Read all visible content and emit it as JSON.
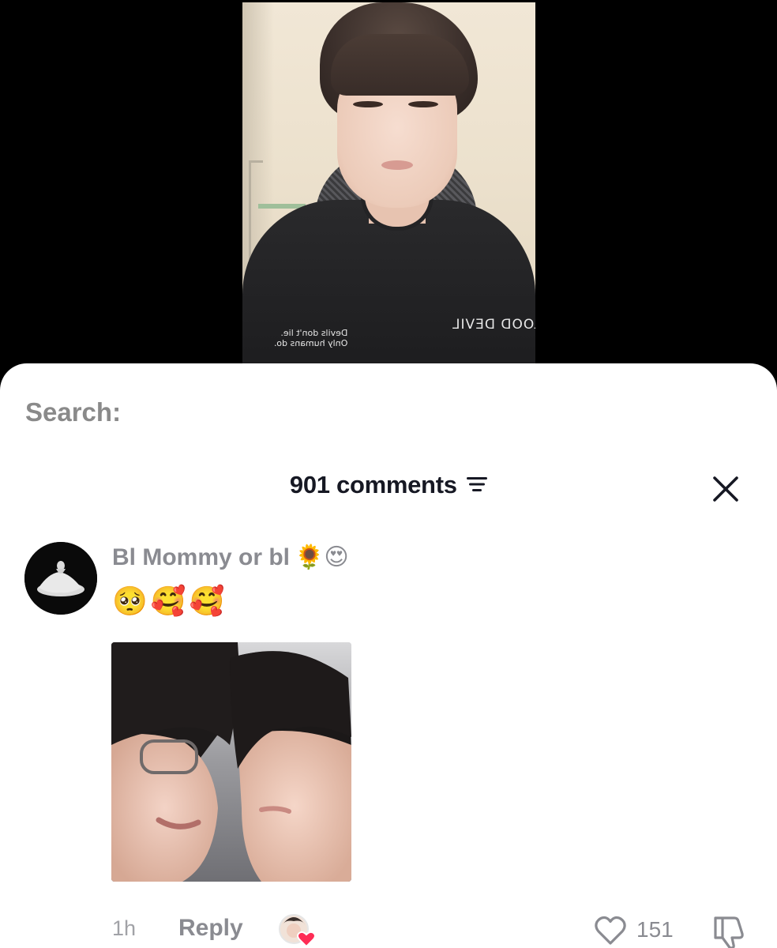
{
  "video": {
    "shirt_text_small": "Devils don't lie.\nOnly humans do.",
    "shirt_text_brand": "BLOOD DEVIL"
  },
  "search": {
    "label": "Search:"
  },
  "comments": {
    "count_label": "901 comments",
    "sort_icon": "sort-lines-icon",
    "close_icon": "close-x-icon"
  },
  "comment": {
    "username": "Bl Mommy or bl",
    "username_emojis": "🌻😍",
    "text": "🥺🥰🥰",
    "timestamp": "1h",
    "reply_label": "Reply",
    "like_count": "151",
    "like_icon": "heart-outline-icon",
    "dislike_icon": "thumbs-down-icon",
    "creator_liked": true
  },
  "colors": {
    "primary_text": "#161823",
    "secondary_text": "#8a8b91",
    "muted_text": "#a1a2a7",
    "accent_heart": "#fe2c55",
    "sheet_bg": "#ffffff",
    "page_bg": "#000000"
  }
}
